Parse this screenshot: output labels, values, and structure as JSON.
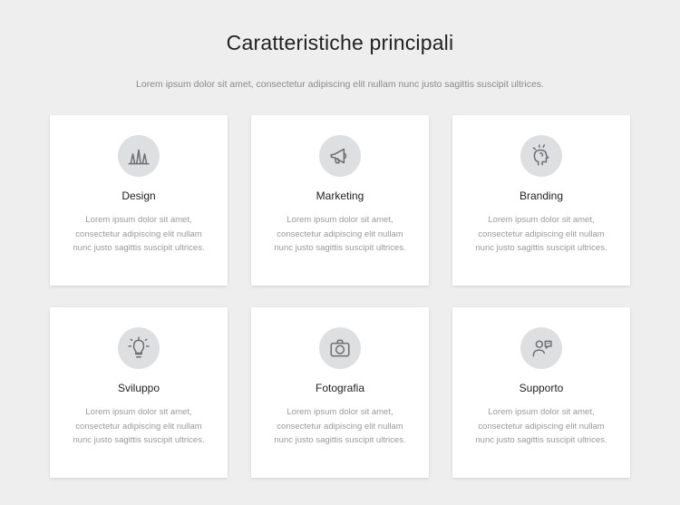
{
  "header": {
    "title": "Caratteristiche principali",
    "subtitle": "Lorem ipsum dolor sit amet, consectetur adipiscing elit nullam nunc justo sagittis suscipit ultrices."
  },
  "cards": [
    {
      "title": "Design",
      "desc": "Lorem ipsum dolor sit amet, consectetur adipiscing elit nullam nunc justo sagittis suscipit ultrices."
    },
    {
      "title": "Marketing",
      "desc": "Lorem ipsum dolor sit amet, consectetur adipiscing elit nullam nunc justo sagittis suscipit ultrices."
    },
    {
      "title": "Branding",
      "desc": "Lorem ipsum dolor sit amet, consectetur adipiscing elit nullam nunc justo sagittis suscipit ultrices."
    },
    {
      "title": "Sviluppo",
      "desc": "Lorem ipsum dolor sit amet, consectetur adipiscing elit nullam nunc justo sagittis suscipit ultrices."
    },
    {
      "title": "Fotografia",
      "desc": "Lorem ipsum dolor sit amet, consectetur adipiscing elit nullam nunc justo sagittis suscipit ultrices."
    },
    {
      "title": "Supporto",
      "desc": "Lorem ipsum dolor sit amet, consectetur adipiscing elit nullam nunc justo sagittis suscipit ultrices."
    }
  ],
  "colors": {
    "accent": "#d8472f",
    "page_bg": "#eeeeee",
    "card_bg": "#ffffff",
    "icon_bg": "#dedfe1"
  }
}
